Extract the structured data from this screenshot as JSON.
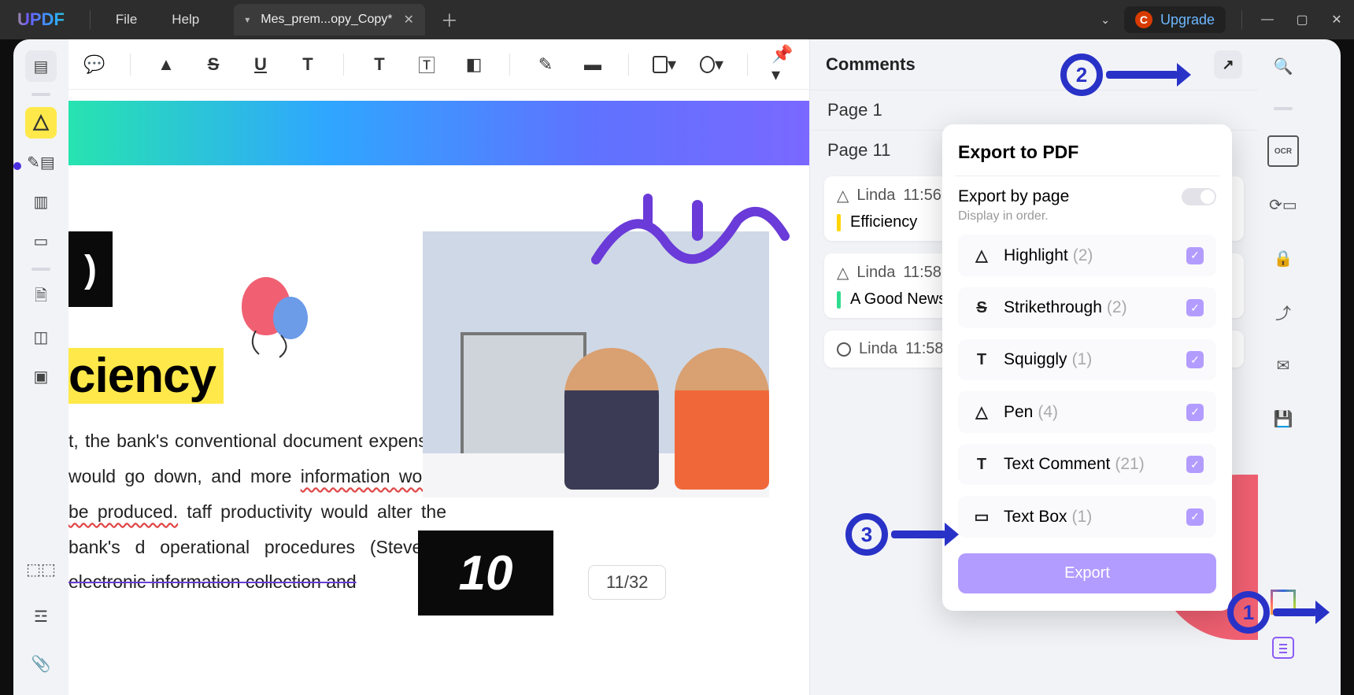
{
  "titlebar": {
    "logo": "UPDF",
    "file": "File",
    "help": "Help",
    "tab": "Mes_prem...opy_Copy*",
    "upgrade_initial": "C",
    "upgrade": "Upgrade"
  },
  "document": {
    "highlight_word": "ciency",
    "big_num": "10",
    "page_indicator": "11/32",
    "para_l1": "t, the bank's conventional document",
    "para_l2": "expenses would go down, and more",
    "para_l3": "information would be produced.",
    "para_l4": "taff productivity would alter the bank's",
    "para_l5": "d operational procedures (Stevens,",
    "para_l6": "electronic information collection and"
  },
  "comments": {
    "title": "Comments",
    "page1": "Page 1",
    "page11": "Page 11",
    "items": [
      {
        "author": "Linda",
        "time": "11:56",
        "kind": "highlight",
        "text": "Efficiency"
      },
      {
        "author": "Linda",
        "time": "11:58",
        "kind": "highlight",
        "text": "A Good News For Developi"
      },
      {
        "author": "Linda",
        "time": "11:58",
        "kind": "pen",
        "text": ""
      }
    ]
  },
  "export": {
    "title": "Export to PDF",
    "bypage": "Export by page",
    "subtitle": "Display in order.",
    "items": [
      {
        "name": "Highlight",
        "count": "(2)",
        "icon": "✎"
      },
      {
        "name": "Strikethrough",
        "count": "(2)",
        "icon": "S"
      },
      {
        "name": "Squiggly",
        "count": "(1)",
        "icon": "T"
      },
      {
        "name": "Pen",
        "count": "(4)",
        "icon": "✎"
      },
      {
        "name": "Text Comment",
        "count": "(21)",
        "icon": "T"
      },
      {
        "name": "Text Box",
        "count": "(1)",
        "icon": "▭"
      }
    ],
    "button": "Export"
  },
  "annotations": {
    "a1": "1",
    "a2": "2",
    "a3": "3"
  }
}
